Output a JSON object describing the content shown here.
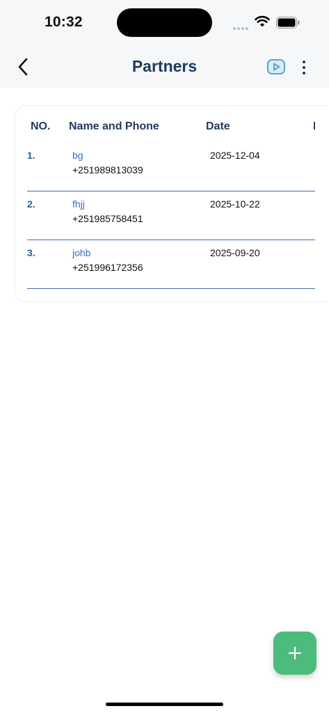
{
  "status_bar": {
    "time": "10:32"
  },
  "header": {
    "title": "Partners"
  },
  "icons": {
    "back": "chevron-left-icon",
    "video": "video-play-icon",
    "more": "more-vertical-icon",
    "add": "plus-icon"
  },
  "colors": {
    "title": "#1f3a5f",
    "link": "#2f74c0",
    "divider": "#3f6ea8",
    "fab": "#4cbc7d",
    "header_bg": "#f6f7f9"
  },
  "table": {
    "columns": [
      "NO.",
      "Name and Phone",
      "Date",
      "I"
    ],
    "rows": [
      {
        "no": "1.",
        "name": "bg",
        "phone": "+251989813039",
        "date": "2025-12-04"
      },
      {
        "no": "2.",
        "name": "fhjj",
        "phone": "+251985758451",
        "date": "2025-10-22"
      },
      {
        "no": "3.",
        "name": "johb",
        "phone": "+251996172356",
        "date": "2025-09-20"
      }
    ]
  }
}
